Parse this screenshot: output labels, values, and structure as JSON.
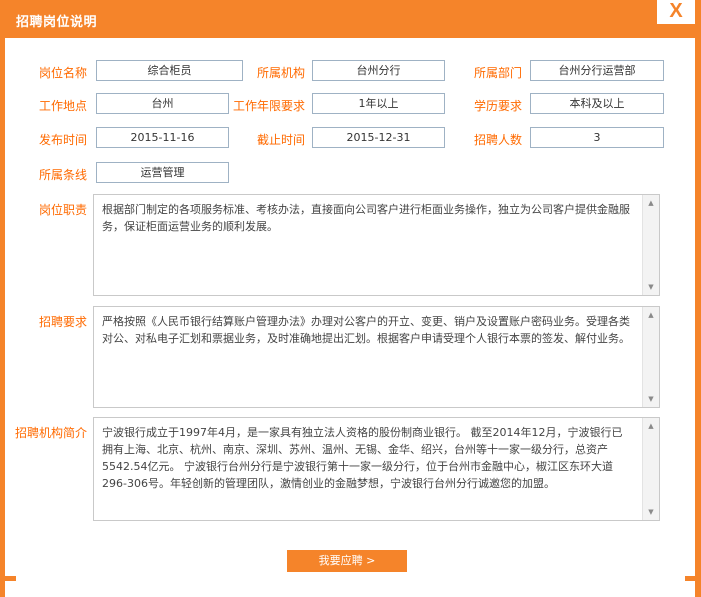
{
  "dialog": {
    "title": "招聘岗位说明",
    "close_label": "X"
  },
  "fields": {
    "position_name": {
      "label": "岗位名称",
      "value": "综合柜员"
    },
    "institution": {
      "label": "所属机构",
      "value": "台州分行"
    },
    "department": {
      "label": "所属部门",
      "value": "台州分行运营部"
    },
    "work_location": {
      "label": "工作地点",
      "value": "台州"
    },
    "experience": {
      "label": "工作年限要求",
      "value": "1年以上"
    },
    "education": {
      "label": "学历要求",
      "value": "本科及以上"
    },
    "publish_time": {
      "label": "发布时间",
      "value": "2015-11-16"
    },
    "deadline": {
      "label": "截止时间",
      "value": "2015-12-31"
    },
    "headcount": {
      "label": "招聘人数",
      "value": "3"
    },
    "business_line": {
      "label": "所属条线",
      "value": "运营管理"
    }
  },
  "sections": {
    "duties": {
      "label": "岗位职责",
      "text": "根据部门制定的各项服务标准、考核办法，直接面向公司客户进行柜面业务操作，独立为公司客户提供金融服务，保证柜面运营业务的顺利发展。"
    },
    "requirements": {
      "label": "招聘要求",
      "text": "严格按照《人民币银行结算账户管理办法》办理对公客户的开立、变更、销户及设置账户密码业务。受理各类对公、对私电子汇划和票据业务，及时准确地提出汇划。根据客户申请受理个人银行本票的签发、解付业务。"
    },
    "institution_intro": {
      "label": "招聘机构简介",
      "text": "宁波银行成立于1997年4月，是一家具有独立法人资格的股份制商业银行。 截至2014年12月，宁波银行已拥有上海、北京、杭州、南京、深圳、苏州、温州、无锡、金华、绍兴，台州等十一家一级分行，总资产5542.54亿元。 宁波银行台州分行是宁波银行第十一家一级分行，位于台州市金融中心，椒江区东环大道296-306号。年轻创新的管理团队，激情创业的金融梦想，宁波银行台州分行诚邀您的加盟。"
    }
  },
  "actions": {
    "apply_label": "我要应聘 >"
  }
}
